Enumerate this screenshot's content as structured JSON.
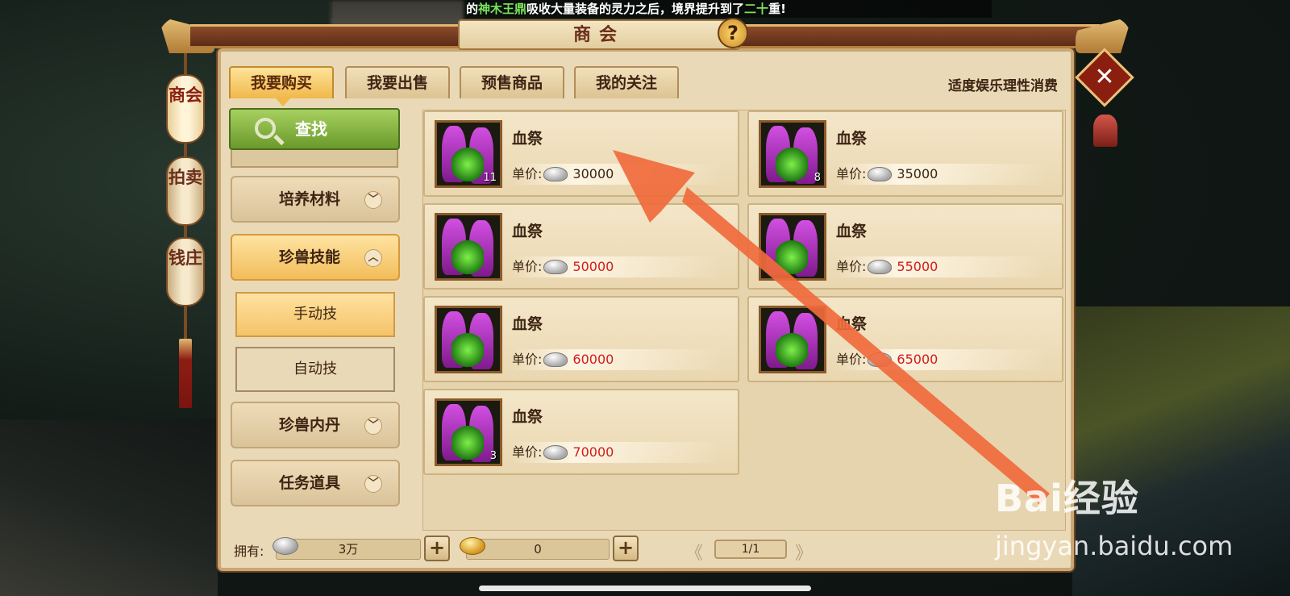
{
  "ticker": {
    "prefix": "的",
    "highlight1": "神木王鼎",
    "middle": "吸收大量装备的灵力之后，境界提升到了",
    "highlight2": "二十",
    "suffix": "重!"
  },
  "window": {
    "title": "商会",
    "help_glyph": "?",
    "close_glyph": "✕"
  },
  "side_tabs": [
    "商会",
    "拍卖",
    "钱庄"
  ],
  "tabs": [
    {
      "label": "我要购买",
      "active": true
    },
    {
      "label": "我要出售",
      "active": false
    },
    {
      "label": "预售商品",
      "active": false
    },
    {
      "label": "我的关注",
      "active": false
    }
  ],
  "moderate_notice": "适度娱乐理性消费",
  "search_label": "查找",
  "categories": [
    {
      "label": "培养材料",
      "chevron": "﹀"
    },
    {
      "label": "珍兽技能",
      "chevron": "︿",
      "open": true
    },
    {
      "label": "珍兽内丹",
      "chevron": "﹀"
    },
    {
      "label": "任务道具",
      "chevron": "﹀"
    }
  ],
  "subcategories": [
    {
      "label": "手动技",
      "active": true
    },
    {
      "label": "自动技",
      "active": false
    }
  ],
  "price_label": "单价:",
  "items": [
    {
      "name": "血祭",
      "qty": "11",
      "price": "30000",
      "red": false
    },
    {
      "name": "血祭",
      "qty": "8",
      "price": "35000",
      "red": false
    },
    {
      "name": "血祭",
      "qty": "",
      "price": "50000",
      "red": true
    },
    {
      "name": "血祭",
      "qty": "",
      "price": "55000",
      "red": true
    },
    {
      "name": "血祭",
      "qty": "",
      "price": "60000",
      "red": true
    },
    {
      "name": "血祭",
      "qty": "",
      "price": "65000",
      "red": true
    },
    {
      "name": "血祭",
      "qty": "3",
      "price": "70000",
      "red": true
    }
  ],
  "bottom": {
    "own_label": "拥有:",
    "silver": "3万",
    "gold": "0",
    "plus": "+",
    "page": "1/1",
    "prev": "《",
    "next": "》"
  },
  "watermark": {
    "logo": "Bai经验",
    "url": "jingyan.baidu.com"
  },
  "colors": {
    "panel": "#ead9b7",
    "accent_gold": "#f0b84a",
    "price_red": "#d21b1b",
    "arrow": "#f06a3c"
  }
}
